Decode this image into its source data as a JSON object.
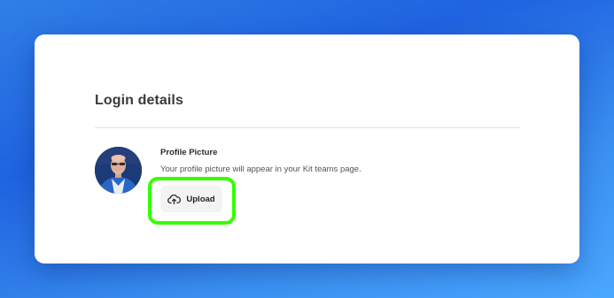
{
  "login_details": {
    "title": "Login details"
  },
  "profile_picture": {
    "label": "Profile Picture",
    "description": "Your profile picture will appear in your Kit teams page.",
    "upload_label": "Upload",
    "upload_icon": "cloud-upload-icon"
  },
  "colors": {
    "background_gradient": [
      "#1f63e0",
      "#4aa7ff"
    ],
    "card": "#ffffff",
    "highlight": "#33ff00",
    "button_bg": "#f3f3f3"
  }
}
